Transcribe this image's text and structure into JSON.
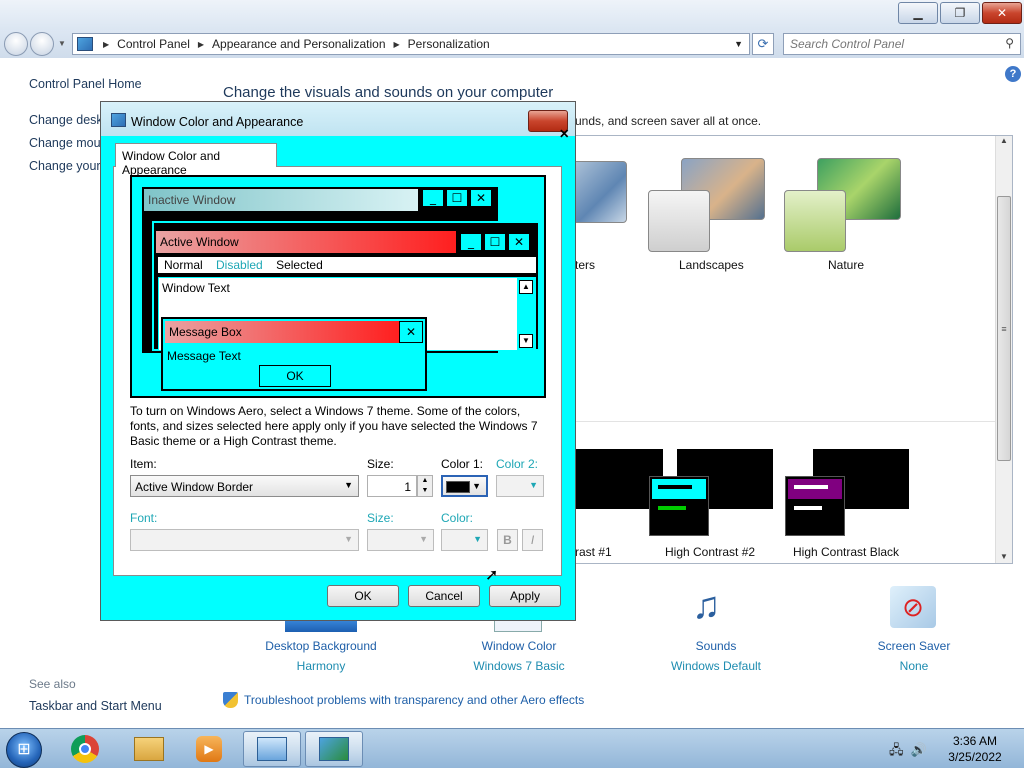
{
  "window": {
    "min_icon": "minimize-icon",
    "max_icon": "restore-icon",
    "close_icon": "close-icon"
  },
  "address": {
    "crumbs": [
      "Control Panel",
      "Appearance and Personalization",
      "Personalization"
    ],
    "search_placeholder": "Search Control Panel"
  },
  "sidebar": {
    "home": "Control Panel Home",
    "links": [
      "Change deskt",
      "Change mous",
      "Change your"
    ],
    "see_also": "See also",
    "taskbar_link": "Taskbar and Start Menu"
  },
  "main": {
    "heading": "Change the visuals and sounds on your computer",
    "subtext": "unds, and screen saver all at once.",
    "themes_row1": [
      "cters",
      "Landscapes",
      "Nature"
    ],
    "themes_row2": [
      "ntrast #1",
      "High Contrast #2",
      "High Contrast Black"
    ],
    "bottom": [
      {
        "title": "Desktop Background",
        "sub": "Harmony"
      },
      {
        "title": "Window Color",
        "sub": "Windows 7 Basic"
      },
      {
        "title": "Sounds",
        "sub": "Windows Default"
      },
      {
        "title": "Screen Saver",
        "sub": "None"
      }
    ],
    "troubleshoot": "Troubleshoot problems with transparency and other Aero effects"
  },
  "dialog": {
    "title": "Window Color and Appearance",
    "tab": "Window Color and Appearance",
    "preview": {
      "inactive": "Inactive Window",
      "active": "Active Window",
      "menu": [
        "Normal",
        "Disabled",
        "Selected"
      ],
      "window_text": "Window Text",
      "msgbox_title": "Message Box",
      "msgbox_text": "Message Text",
      "msgbox_ok": "OK"
    },
    "instructions": "To turn on Windows Aero, select a Windows 7 theme.  Some of the colors, fonts, and sizes selected here apply only if you have selected the Windows 7 Basic theme or a High Contrast theme.",
    "item_label": "Item:",
    "item_value": "Active Window Border",
    "size_label": "Size:",
    "size_value": "1",
    "color1_label": "Color 1:",
    "color2_label": "Color 2:",
    "font_label": "Font:",
    "font_size_label": "Size:",
    "font_color_label": "Color:",
    "bold": "B",
    "italic": "I",
    "ok": "OK",
    "cancel": "Cancel",
    "apply": "Apply",
    "colors": {
      "cyan": "#00ffff",
      "active_title": "#ff1f1f",
      "color1": "#000000"
    }
  },
  "taskbar": {
    "time": "3:36 AM",
    "date": "3/25/2022",
    "apps": [
      "windows-explorer-icon",
      "chrome-icon",
      "libraries-icon",
      "media-player-icon",
      "control-panel-icon",
      "personalization-icon"
    ]
  }
}
